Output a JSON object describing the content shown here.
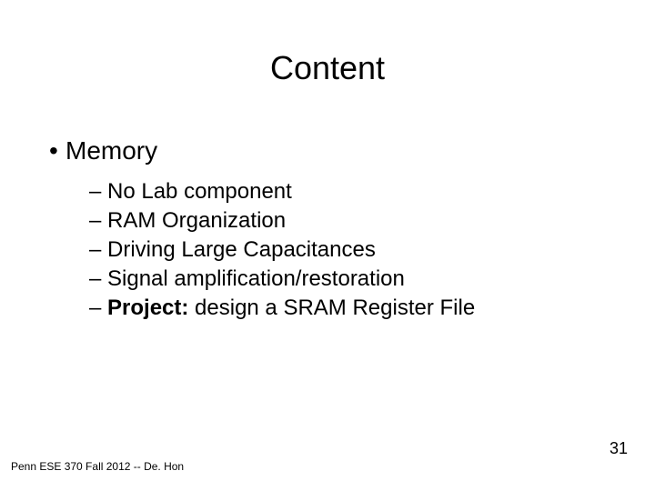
{
  "title": "Content",
  "main_bullet": "Memory",
  "sub_items": [
    {
      "text": "No Lab component"
    },
    {
      "text": "RAM Organization"
    },
    {
      "text": "Driving Large Capacitances"
    },
    {
      "text": "Signal amplification/restoration"
    }
  ],
  "project_label": "Project:",
  "project_text": " design a SRAM Register File",
  "footer": "Penn ESE 370 Fall 2012 -- De. Hon",
  "page_number": "31"
}
